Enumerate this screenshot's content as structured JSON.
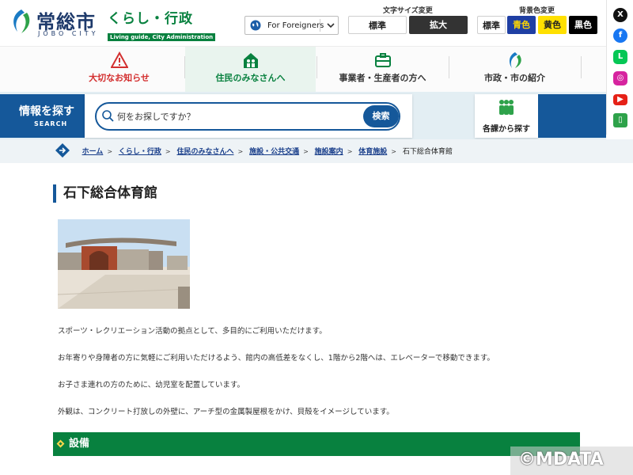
{
  "header": {
    "logo_name": "常総市",
    "logo_roman": "JOBO CITY",
    "section_title": "くらし・行政",
    "section_subtitle": "Living guide, City Administration",
    "foreigners_label": "For Foreigners",
    "font_size_caption": "文字サイズ変更",
    "font_size_standard": "標準",
    "font_size_large": "拡大",
    "bg_caption": "背景色変更",
    "bg_standard": "標準",
    "bg_blue": "青色",
    "bg_yellow": "黄色",
    "bg_black": "黒色"
  },
  "nav": {
    "items": [
      {
        "label": "大切なお知らせ",
        "icon": "warning-icon",
        "color": "#d32f2f"
      },
      {
        "label": "住民のみなさんへ",
        "icon": "house-people-icon",
        "color": "#08813f"
      },
      {
        "label": "事業者・生産者の方へ",
        "icon": "briefcase-icon",
        "color": "#333333"
      },
      {
        "label": "市政・市の紹介",
        "icon": "city-leaf-icon",
        "color": "#333333"
      }
    ]
  },
  "search": {
    "heading": "情報を探す",
    "heading_en": "SEARCH",
    "placeholder": "何をお探しですか？",
    "button": "検索",
    "dept_button": "各課から探す"
  },
  "breadcrumb": {
    "items": [
      "ホーム",
      "くらし・行政",
      "住民のみなさんへ",
      "施設・公共交通",
      "施設案内",
      "体育施設"
    ],
    "current": "石下総合体育館"
  },
  "page": {
    "title": "石下総合体育館",
    "paragraphs": [
      "スポーツ・レクリエーション活動の拠点として、多目的にご利用いただけます。",
      "お年寄りや身障者の方に気軽にご利用いただけるよう、館内の高低差をなくし、1階から2階へは、エレベーターで移動できます。",
      "お子さま連れの方のために、幼児室を配置しています。",
      "外観は、コンクリート打放しの外壁に、アーチ型の金属製屋根をかけ、貝殻をイメージしています。"
    ],
    "section_heading": "設備"
  },
  "watermark": "©MDATA",
  "colors": {
    "brand_blue": "#15589a",
    "brand_green": "#08813f",
    "alert_red": "#d32f2f"
  }
}
